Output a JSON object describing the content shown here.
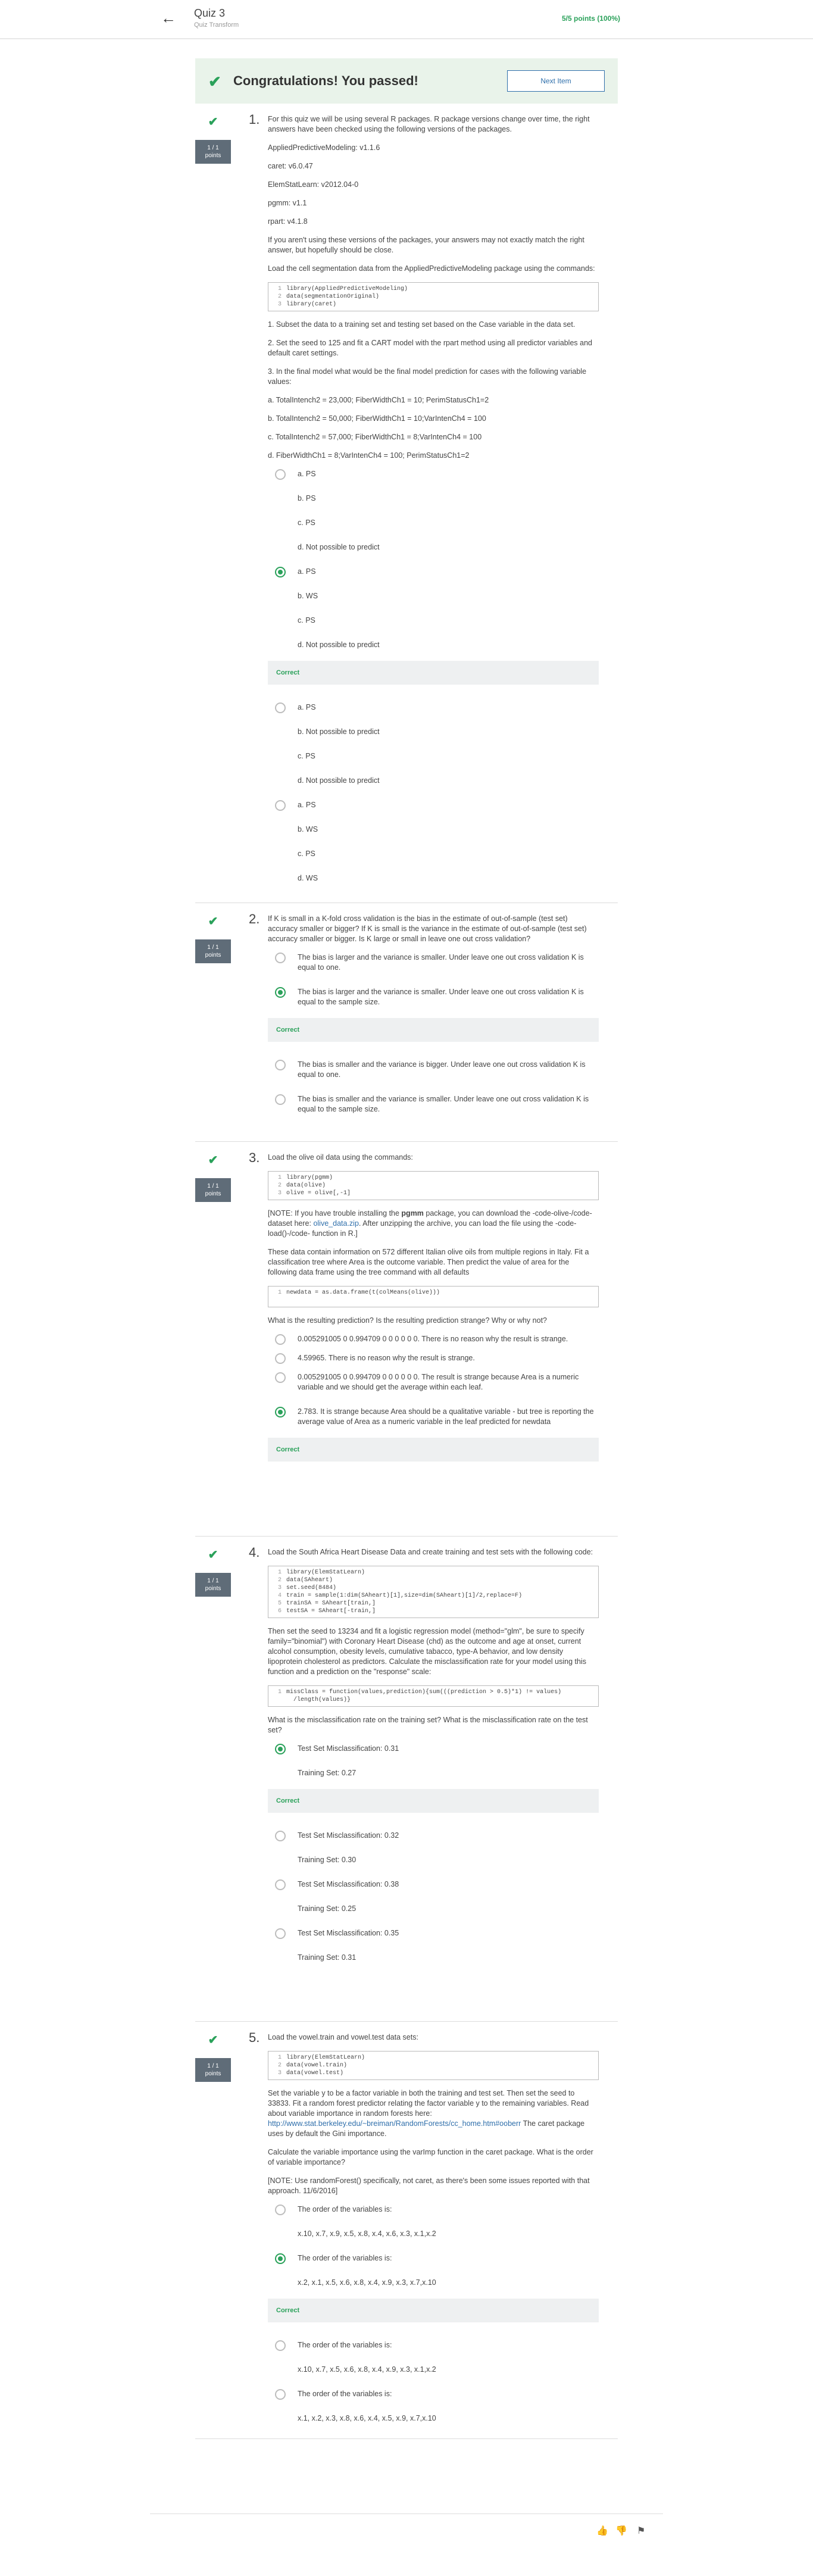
{
  "header": {
    "back_icon": "arrow-left-icon",
    "title": "Quiz 3",
    "subtitle": "Quiz Transform",
    "points": "5/5 points (100%)"
  },
  "banner": {
    "title": "Congratulations! You passed!",
    "next_label": "Next Item"
  },
  "badge": "1 / 1\npoints",
  "q1": {
    "num": "1.",
    "p": [
      "For this quiz we will be using several R packages. R package versions change over time, the right answers have been checked using the following versions of the packages.",
      "AppliedPredictiveModeling: v1.1.6",
      "caret: v6.0.47",
      "ElemStatLearn: v2012.04-0",
      "pgmm: v1.1",
      "rpart: v4.1.8",
      "If you aren't using these versions of the packages, your answers may not exactly match the right answer, but hopefully should be close.",
      "Load the cell segmentation data from the AppliedPredictiveModeling package using the commands:"
    ],
    "code": [
      "library(AppliedPredictiveModeling)",
      "data(segmentationOriginal)",
      "library(caret)"
    ],
    "p2": [
      "1. Subset the data to a training set and testing set based on the Case variable in the data set.",
      "2. Set the seed to 125 and fit a CART model with the rpart method using all predictor variables and default caret settings.",
      "3. In the final model what would be the final model prediction for cases with the following variable values:",
      "a. TotalIntench2 = 23,000; FiberWidthCh1 = 10; PerimStatusCh1=2",
      "b. TotalIntench2 = 50,000; FiberWidthCh1 = 10;VarIntenCh4 = 100",
      "c. TotalIntench2 = 57,000; FiberWidthCh1 = 8;VarIntenCh4 = 100",
      "d. FiberWidthCh1 = 8;VarIntenCh4 = 100; PerimStatusCh1=2"
    ],
    "opt1": [
      "a. PS",
      "b. PS",
      "c. PS",
      "d. Not possible to predict"
    ],
    "opt2": [
      "a. PS",
      "b. WS",
      "c. PS",
      "d. Not possible to predict"
    ],
    "opt3": [
      "a. PS",
      "b. Not possible to predict",
      "c. PS",
      "d. Not possible to predict"
    ],
    "opt4": [
      "a. PS",
      "b. WS",
      "c. PS",
      "d. WS"
    ],
    "feedback": "Correct"
  },
  "q2": {
    "num": "2.",
    "text": "If K is small in a K-fold cross validation is the bias in the estimate of out-of-sample (test set) accuracy smaller or bigger? If K is small is the variance in the estimate of out-of-sample (test set) accuracy smaller or bigger. Is K large or small in leave one out cross validation?",
    "options": [
      "The bias is larger and the variance is smaller. Under leave one out cross validation K is equal to one.",
      "The bias is larger and the variance is smaller. Under leave one out cross validation K is equal to the sample size.",
      "The bias is smaller and the variance is bigger. Under leave one out cross validation K is equal to one.",
      "The bias is smaller and the variance is smaller. Under leave one out cross validation K is equal to the sample size."
    ],
    "feedback": "Correct"
  },
  "q3": {
    "num": "3.",
    "p1": "Load the olive oil data using the commands:",
    "code": [
      "library(pgmm)",
      "data(olive)",
      "olive = olive[,-1]"
    ],
    "note_a": "[NOTE: If you have trouble installing the ",
    "note_pkg": "pgmm",
    "note_b": " package, you can download the -code-olive-/code- dataset here: ",
    "note_link": "olive_data.zip",
    "note_c": ". After unzipping the archive, you can load the file using the -code-load()-/code- function in R.]",
    "p2": "These data contain information on 572 different Italian olive oils from multiple regions in Italy. Fit a classification tree where Area is the outcome variable. Then predict the value of area for the following data frame using the tree command with all defaults",
    "code2": [
      "newdata = as.data.frame(t(colMeans(olive)))"
    ],
    "p3": "What is the resulting prediction? Is the resulting prediction strange? Why or why not?",
    "options": [
      "0.005291005 0 0.994709 0 0 0 0 0 0. There is no reason why the result is strange.",
      "4.59965. There is no reason why the result is strange.",
      "0.005291005 0 0.994709 0 0 0 0 0 0. The result is strange because Area is a numeric variable and we should get the average within each leaf.",
      "2.783. It is strange because Area should be a qualitative variable - but tree is reporting the average value of Area as a numeric variable in the leaf predicted for newdata"
    ],
    "feedback": "Correct"
  },
  "q4": {
    "num": "4.",
    "p1": "Load the South Africa Heart Disease Data and create training and test sets with the following code:",
    "code": [
      "library(ElemStatLearn)",
      "data(SAheart)",
      "set.seed(8484)",
      "train = sample(1:dim(SAheart)[1],size=dim(SAheart)[1]/2,replace=F)",
      "trainSA = SAheart[train,]",
      "testSA = SAheart[-train,]"
    ],
    "p2": "Then set the seed to 13234 and fit a logistic regression model (method=\"glm\", be sure to specify family=\"binomial\") with Coronary Heart Disease (chd) as the outcome and age at onset, current alcohol consumption, obesity levels, cumulative tabacco, type-A behavior, and low density lipoprotein cholesterol as predictors. Calculate the misclassification rate for your model using this function and a prediction on the \"response\" scale:",
    "code2": [
      "missClass = function(values,prediction){sum(((prediction > 0.5)*1) != values)",
      "  /length(values)}"
    ],
    "p3": "What is the misclassification rate on the training set? What is the misclassification rate on the test set?",
    "opt1": [
      "Test Set Misclassification: 0.31",
      "Training Set: 0.27"
    ],
    "opt2": [
      "Test Set Misclassification: 0.32",
      "Training Set: 0.30"
    ],
    "opt3": [
      "Test Set Misclassification: 0.38",
      "Training Set: 0.25"
    ],
    "opt4": [
      "Test Set Misclassification: 0.35",
      "Training Set: 0.31"
    ],
    "feedback": "Correct"
  },
  "q5": {
    "num": "5.",
    "p1": "Load the vowel.train and vowel.test data sets:",
    "code": [
      "library(ElemStatLearn)",
      "data(vowel.train)",
      "data(vowel.test)"
    ],
    "p2": "Set the variable y to be a factor variable in both the training and test set. Then set the seed to 33833. Fit a random forest predictor relating the factor variable y to the remaining variables. Read about variable importance in random forests here: ",
    "link": "http://www.stat.berkeley.edu/~breiman/RandomForests/cc_home.htm#ooberr",
    "p2b": " The caret package uses by default the Gini importance.",
    "p3": "Calculate the variable importance using the varImp function in the caret package. What is the order of variable importance?",
    "p4": "[NOTE: Use randomForest() specifically, not caret, as there's been some issues reported with that approach. 11/6/2016]",
    "opt_head": "The order of the variables is:",
    "opt1": "x.10, x.7, x.9, x.5, x.8, x.4, x.6, x.3, x.1,x.2",
    "opt2": "x.2, x.1, x.5, x.6, x.8, x.4, x.9, x.3, x.7,x.10",
    "opt3": "x.10, x.7, x.5, x.6, x.8, x.4, x.9, x.3, x.1,x.2",
    "opt4": "x.1, x.2, x.3, x.8, x.6, x.4, x.5, x.9, x.7,x.10",
    "feedback": "Correct"
  },
  "footer": {
    "like_icon": "thumbs-up-icon",
    "dislike_icon": "thumbs-down-icon",
    "flag_icon": "flag-icon"
  }
}
